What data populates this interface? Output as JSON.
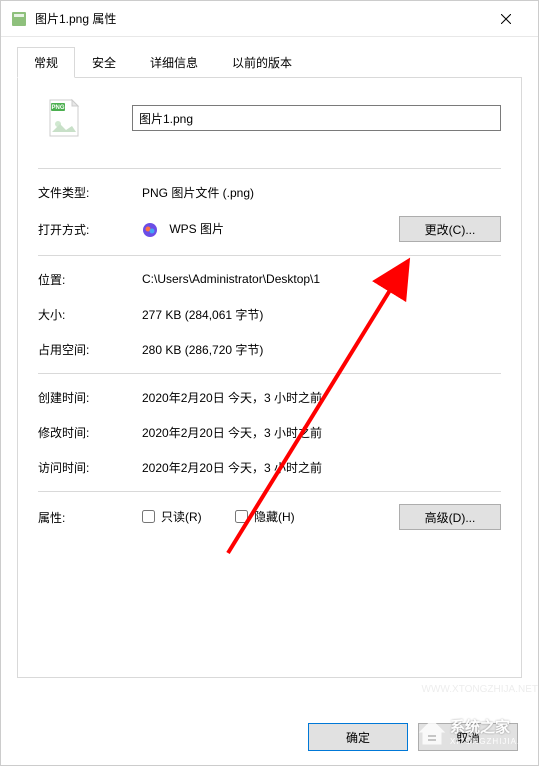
{
  "window": {
    "title": "图片1.png 属性"
  },
  "tabs": {
    "general": "常规",
    "security": "安全",
    "details": "详细信息",
    "previous": "以前的版本"
  },
  "filename": "图片1.png",
  "fields": {
    "filetype_label": "文件类型:",
    "filetype_value": "PNG 图片文件 (.png)",
    "openwith_label": "打开方式:",
    "openwith_value": "WPS 图片",
    "change_btn": "更改(C)...",
    "location_label": "位置:",
    "location_value": "C:\\Users\\Administrator\\Desktop\\1",
    "size_label": "大小:",
    "size_value": "277 KB (284,061 字节)",
    "ondisk_label": "占用空间:",
    "ondisk_value": "280 KB (286,720 字节)",
    "created_label": "创建时间:",
    "created_value": "2020年2月20日 今天，3 小时之前",
    "modified_label": "修改时间:",
    "modified_value": "2020年2月20日 今天，3 小时之前",
    "accessed_label": "访问时间:",
    "accessed_value": "2020年2月20日 今天，3 小时之前",
    "attr_label": "属性:",
    "readonly_label": "只读(R)",
    "hidden_label": "隐藏(H)",
    "advanced_btn": "高级(D)..."
  },
  "footer": {
    "ok": "确定",
    "cancel": "取消"
  },
  "watermark": {
    "url": "WWW.XTONGZHIJA.NET",
    "brand": "系统之家",
    "sub": "XITONGZHIJIA.NET"
  }
}
